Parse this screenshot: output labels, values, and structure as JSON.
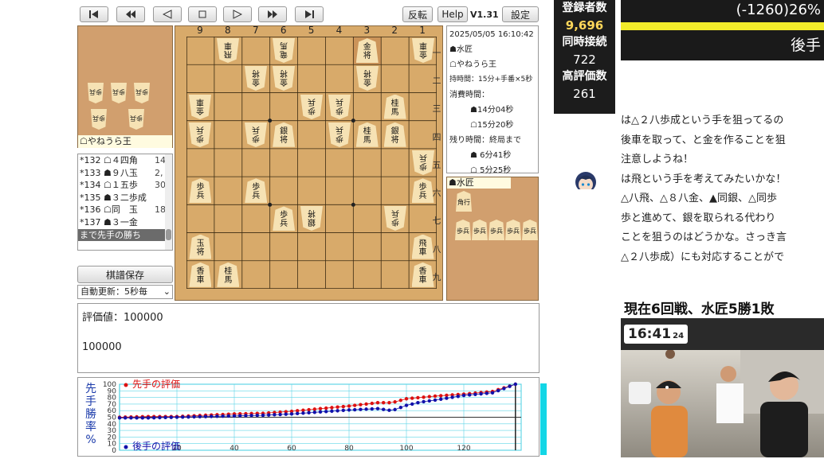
{
  "toolbar": {
    "flip_label": "反転",
    "help_label": "Help",
    "version": "V1.31",
    "settings_label": "設定"
  },
  "board": {
    "file_labels": [
      "9",
      "8",
      "7",
      "6",
      "5",
      "4",
      "3",
      "2",
      "1"
    ],
    "rank_labels": [
      "一",
      "二",
      "三",
      "四",
      "五",
      "六",
      "七",
      "八",
      "九"
    ],
    "pieces": [
      {
        "f": 8,
        "r": 1,
        "t": "飛車",
        "g": true
      },
      {
        "f": 6,
        "r": 1,
        "t": "竜馬",
        "g": true
      },
      {
        "f": 3,
        "r": 1,
        "t": "金将",
        "g": false
      },
      {
        "f": 1,
        "r": 1,
        "t": "金車",
        "g": true
      },
      {
        "f": 7,
        "r": 2,
        "t": "金将",
        "g": true
      },
      {
        "f": 6,
        "r": 2,
        "t": "金将",
        "g": true
      },
      {
        "f": 3,
        "r": 2,
        "t": "金将",
        "g": true
      },
      {
        "f": 9,
        "r": 3,
        "t": "金車",
        "g": true
      },
      {
        "f": 5,
        "r": 3,
        "t": "歩兵",
        "g": true
      },
      {
        "f": 4,
        "r": 3,
        "t": "歩兵",
        "g": true
      },
      {
        "f": 2,
        "r": 3,
        "t": "桂馬",
        "g": false
      },
      {
        "f": 9,
        "r": 4,
        "t": "歩兵",
        "g": true
      },
      {
        "f": 7,
        "r": 4,
        "t": "歩兵",
        "g": true
      },
      {
        "f": 6,
        "r": 4,
        "t": "銀将",
        "g": false
      },
      {
        "f": 4,
        "r": 4,
        "t": "歩兵",
        "g": true
      },
      {
        "f": 3,
        "r": 4,
        "t": "桂馬",
        "g": false
      },
      {
        "f": 2,
        "r": 4,
        "t": "銀将",
        "g": false
      },
      {
        "f": 1,
        "r": 5,
        "t": "歩兵",
        "g": true
      },
      {
        "f": 9,
        "r": 6,
        "t": "歩兵",
        "g": false
      },
      {
        "f": 7,
        "r": 6,
        "t": "歩兵",
        "g": false
      },
      {
        "f": 1,
        "r": 6,
        "t": "歩兵",
        "g": false
      },
      {
        "f": 6,
        "r": 7,
        "t": "歩兵",
        "g": false
      },
      {
        "f": 5,
        "r": 7,
        "t": "銀将",
        "g": true
      },
      {
        "f": 2,
        "r": 7,
        "t": "歩兵",
        "g": true
      },
      {
        "f": 9,
        "r": 8,
        "t": "玉将",
        "g": false
      },
      {
        "f": 1,
        "r": 8,
        "t": "飛車",
        "g": false
      },
      {
        "f": 9,
        "r": 9,
        "t": "香車",
        "g": false
      },
      {
        "f": 8,
        "r": 9,
        "t": "桂馬",
        "g": false
      },
      {
        "f": 1,
        "r": 9,
        "t": "香車",
        "g": false
      }
    ]
  },
  "gote_hand": {
    "name": "☖やねうら王",
    "pieces": [
      "歩兵",
      "歩兵",
      "歩兵",
      "歩兵",
      "歩兵"
    ]
  },
  "sente_hand": {
    "name": "☗水匠",
    "pieces": [
      "角行",
      "歩兵",
      "歩兵",
      "歩兵",
      "歩兵",
      "歩兵"
    ]
  },
  "info": {
    "datetime": "2025/05/05 16:10:42",
    "sente": "☗水匠",
    "gote": "☖やねうら王",
    "time_control": "持時間：15分+手番×5秒",
    "used_label": "消費時間：",
    "sente_used": "☗14分04秒",
    "gote_used": "☖15分20秒",
    "remain_label": "残り時間：終局まで",
    "sente_remain": "☗ 6分41秒",
    "gote_remain": "☖ 5分25秒"
  },
  "moves": [
    {
      "mark": "*",
      "text": "132 ☖４四角",
      "time": "14"
    },
    {
      "mark": "*",
      "text": "133 ☗９八玉",
      "time": "2,"
    },
    {
      "mark": "*",
      "text": "134 ☖１五歩",
      "time": "30"
    },
    {
      "mark": "*",
      "text": "135 ☗３二歩成",
      "time": ""
    },
    {
      "mark": "*",
      "text": "136 ☖同　玉",
      "time": "18"
    },
    {
      "mark": "*",
      "text": "137 ☗３一金",
      "time": ""
    }
  ],
  "result_text": "まで先手の勝ち",
  "save_label": "棋譜保存",
  "auto_update": "自動更新：5秒毎",
  "eval": {
    "line1": "評価値：100000",
    "line2": "100000"
  },
  "chart_data": {
    "type": "line",
    "ylabel": "先手勝率%",
    "xlim": [
      0,
      140
    ],
    "ylim": [
      0,
      100
    ],
    "x_ticks": [
      20,
      40,
      60,
      80,
      100,
      120,
      140
    ],
    "y_ticks": [
      0,
      10,
      20,
      30,
      40,
      50,
      60,
      70,
      80,
      90,
      100
    ],
    "series": [
      {
        "name": "先手の評価",
        "color": "#dd1111",
        "x": [
          0,
          10,
          20,
          30,
          40,
          50,
          60,
          70,
          80,
          90,
          95,
          100,
          105,
          110,
          120,
          130,
          138
        ],
        "y": [
          50,
          51,
          51,
          53,
          55,
          56,
          59,
          63,
          67,
          72,
          72,
          78,
          80,
          82,
          85,
          89,
          100
        ]
      },
      {
        "name": "後手の評価",
        "color": "#1111aa",
        "x": [
          0,
          10,
          20,
          30,
          40,
          50,
          60,
          70,
          80,
          90,
          95,
          100,
          105,
          110,
          120,
          130,
          138
        ],
        "y": [
          49,
          49,
          50,
          51,
          52,
          53,
          55,
          58,
          61,
          63,
          60,
          68,
          73,
          76,
          83,
          87,
          100
        ]
      }
    ]
  },
  "stats": {
    "registered_label": "登録者数",
    "registered": "9,696",
    "concurrent_label": "同時接続",
    "concurrent": "722",
    "rating_label": "高評価数",
    "rating": "261"
  },
  "score_bar": {
    "eval": "(-1260)26%",
    "side": "後手"
  },
  "commentary": [
    "は△２八歩成という手を狙ってるの",
    "後車を取って、と金を作ることを狙",
    "注意しようね！",
    "は飛という手を考えてみたいかな！",
    "△八飛、△８八金、▲同銀、△同歩",
    "歩と進めて、銀を取られる代わり",
    "ことを狙うのはどうかな。さっき言",
    "△２八歩成）にも対応することがで"
  ],
  "video": {
    "headline": "現在6回戦、水匠5勝1敗",
    "clock": "16:41",
    "clock_sec": "24"
  },
  "colors": {
    "board": "#d8aa6a",
    "hand": "#d19f6e",
    "sente_line": "#dd1111",
    "gote_line": "#1111aa",
    "stream_dark": "#1c1c1c",
    "score_yellow": "#f2ec2a"
  }
}
